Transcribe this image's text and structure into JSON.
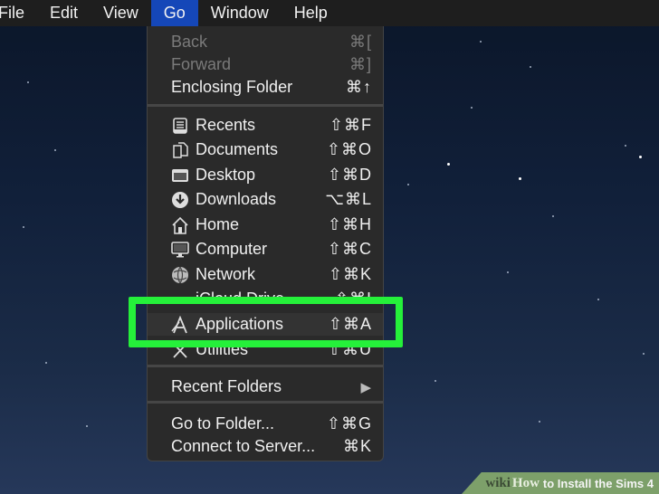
{
  "menubar": {
    "items": [
      "File",
      "Edit",
      "View",
      "Go",
      "Window",
      "Help"
    ],
    "active": "Go",
    "active_color": "#1547b8"
  },
  "go_menu": {
    "history": [
      {
        "label": "Back",
        "shortcut": "⌘[",
        "enabled": false
      },
      {
        "label": "Forward",
        "shortcut": "⌘]",
        "enabled": false
      },
      {
        "label": "Enclosing Folder",
        "shortcut": "⌘↑",
        "enabled": true
      }
    ],
    "places": [
      {
        "label": "Recents",
        "shortcut": "⇧⌘F",
        "icon": "recents-icon"
      },
      {
        "label": "Documents",
        "shortcut": "⇧⌘O",
        "icon": "documents-icon"
      },
      {
        "label": "Desktop",
        "shortcut": "⇧⌘D",
        "icon": "desktop-icon"
      },
      {
        "label": "Downloads",
        "shortcut": "⌥⌘L",
        "icon": "downloads-icon"
      },
      {
        "label": "Home",
        "shortcut": "⇧⌘H",
        "icon": "home-icon"
      },
      {
        "label": "Computer",
        "shortcut": "⇧⌘C",
        "icon": "computer-icon"
      },
      {
        "label": "Network",
        "shortcut": "⇧⌘K",
        "icon": "network-icon"
      },
      {
        "label": "iCloud Drive",
        "shortcut": "⇧⌘I",
        "icon": "icloud-icon"
      },
      {
        "label": "Applications",
        "shortcut": "⇧⌘A",
        "icon": "applications-icon"
      },
      {
        "label": "Utilities",
        "shortcut": "⇧⌘U",
        "icon": "utilities-icon"
      }
    ],
    "recent_folders": {
      "label": "Recent Folders",
      "submenu_arrow": "▶"
    },
    "goto": [
      {
        "label": "Go to Folder...",
        "shortcut": "⇧⌘G"
      },
      {
        "label": "Connect to Server...",
        "shortcut": "⌘K"
      }
    ]
  },
  "highlight": {
    "target": "Applications",
    "color": "#25f03a"
  },
  "watermark": {
    "wiki": "wiki",
    "how": "How",
    "title": "to Install the Sims 4"
  }
}
